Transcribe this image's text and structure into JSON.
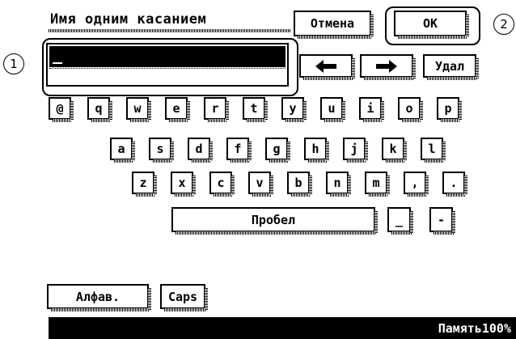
{
  "dialog": {
    "title": "Имя одним касанием",
    "cancel_label": "Отмена",
    "ok_label": "OK"
  },
  "callouts": {
    "one": "1",
    "two": "2"
  },
  "input": {
    "value": ""
  },
  "edit_keys": {
    "left_icon": "left-arrow-icon",
    "right_icon": "right-arrow-icon",
    "delete_label": "Удал"
  },
  "keyboard": {
    "row1": [
      "@",
      "q",
      "w",
      "e",
      "r",
      "t",
      "y",
      "u",
      "i",
      "o",
      "p"
    ],
    "row2": [
      "a",
      "s",
      "d",
      "f",
      "g",
      "h",
      "j",
      "k",
      "l"
    ],
    "row3": [
      "z",
      "x",
      "c",
      "v",
      "b",
      "n",
      "m",
      ",",
      "."
    ],
    "space_label": "Пробел",
    "underscore_label": "_",
    "dash_label": "-"
  },
  "mode_buttons": {
    "alpha_label": "Алфав.",
    "caps_label": "Caps"
  },
  "status": {
    "memory": "Память100%"
  }
}
